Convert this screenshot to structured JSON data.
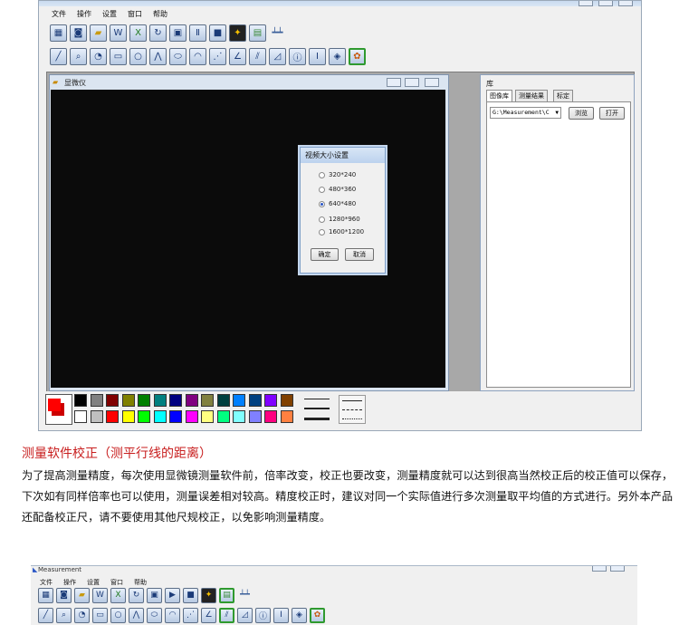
{
  "menu": [
    "文件",
    "操作",
    "设置",
    "窗口",
    "帮助"
  ],
  "toolbar_row1_icons": [
    "video-icon",
    "camera-icon",
    "folder-open-icon",
    "word-export-icon",
    "excel-export-icon",
    "refresh-icon",
    "save-icon",
    "pause-icon",
    "stop-icon",
    "wrench-icon",
    "grid-icon",
    "ruler-icon"
  ],
  "toolbar_row2_icons": [
    "line-icon",
    "zoom-icon",
    "circle-tool-icon",
    "rectangle-icon",
    "ellipse-icon",
    "polyline-icon",
    "oval-icon",
    "arc-icon",
    "point-line-icon",
    "angle-icon",
    "parallel-lines-icon",
    "protractor-icon",
    "info-icon",
    "column-icon",
    "diamond-icon",
    "palette-icon"
  ],
  "microscope_window": {
    "title": "显微仪"
  },
  "dialog": {
    "title": "视频大小设置",
    "options": [
      "320*240",
      "480*360",
      "640*480",
      "1280*960",
      "1600*1200"
    ],
    "selected_index": 2,
    "ok_label": "确定",
    "cancel_label": "取消"
  },
  "library": {
    "title": "库",
    "tabs": [
      "图像库",
      "测量结果",
      "标定"
    ],
    "path_value": "G:\\Measurement\\C",
    "browse_label": "浏览",
    "open_label": "打开"
  },
  "palette": {
    "row1": [
      "#000000",
      "#808080",
      "#800000",
      "#808000",
      "#008000",
      "#008080",
      "#000080",
      "#800080",
      "#808040",
      "#004040",
      "#0080ff",
      "#004080",
      "#8000ff",
      "#804000"
    ],
    "row2": [
      "#ffffff",
      "#c0c0c0",
      "#ff0000",
      "#ffff00",
      "#00ff00",
      "#00ffff",
      "#0000ff",
      "#ff00ff",
      "#ffff80",
      "#00ff80",
      "#80ffff",
      "#8080ff",
      "#ff0080",
      "#ff8040"
    ],
    "current_fg": "#ff0000",
    "current_bg": "#cc0000"
  },
  "article": {
    "heading": "测量软件校正（测平行线的距离）",
    "body": "为了提高测量精度，每次使用显微镜测量软件前，倍率改变，校正也要改变，测量精度就可以达到很高当然校正后的校正值可以保存，下次如有同样倍率也可以使用，测量误差相对较高。精度校正时，建议对同一个实际值进行多次测量取平均值的方式进行。另外本产品还配备校正尺，请不要使用其他尺规校正，以免影响测量精度。"
  },
  "second_window": {
    "title": "Measurement",
    "menu": [
      "文件",
      "操作",
      "设置",
      "窗口",
      "帮助"
    ]
  }
}
